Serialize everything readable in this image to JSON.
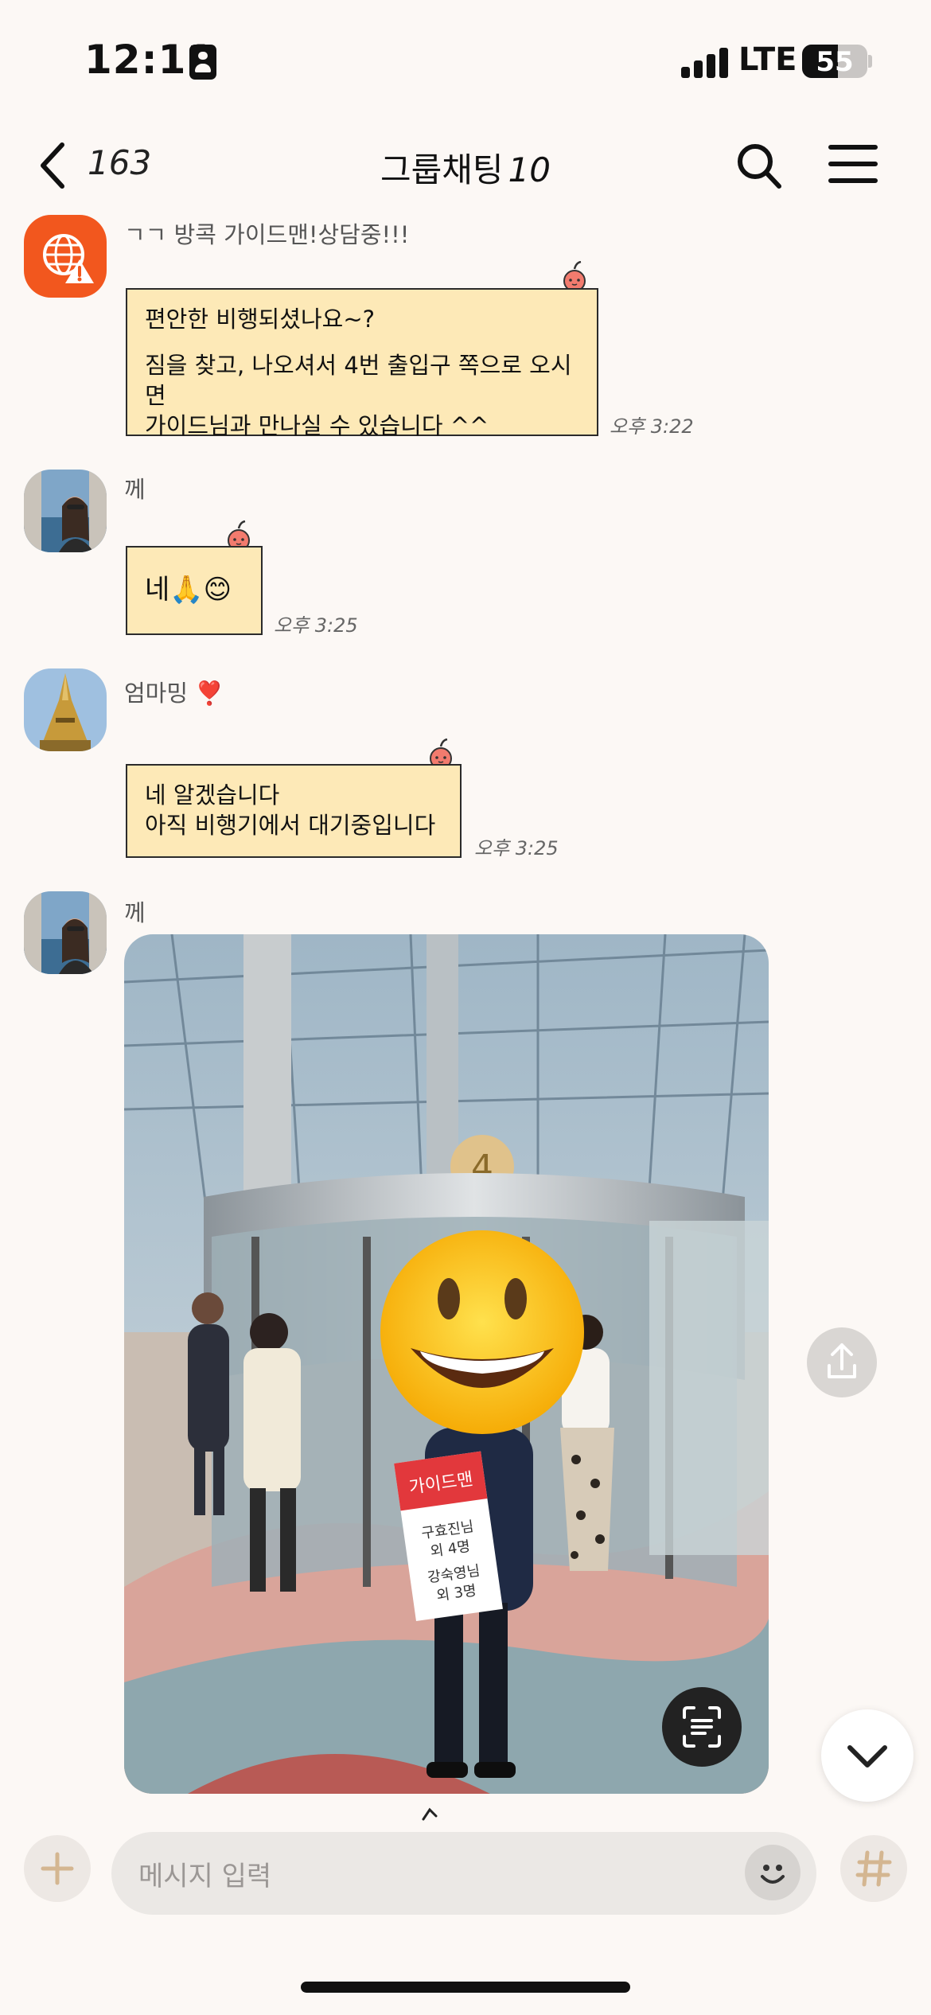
{
  "status_bar": {
    "time": "12:11",
    "network": "LTE",
    "battery": "55"
  },
  "nav": {
    "back_count": "163",
    "title": "그룹채팅",
    "member_count": "10"
  },
  "messages": [
    {
      "sender": "ㄱㄱ 방콕 가이드맨!상담중!!!",
      "line1": "편안한 비행되셨나요~?",
      "line2": "짐을 찾고, 나오셔서 4번 출입구 쪽으로 오시면",
      "line3": "가이드님과 만나실 수 있습니다 ^^",
      "time": "오후 3:22"
    },
    {
      "sender": "께",
      "text": "네🙏😊",
      "time": "오후 3:25"
    },
    {
      "sender": "엄마밍 ❣️",
      "line1": "네  알겠습니다",
      "line2": "아직  비행기에서  대기중입니다",
      "time": "오후 3:25"
    },
    {
      "sender": "께"
    }
  ],
  "photo": {
    "sign_brand": "가이드맨",
    "sign_line1": "구효진님",
    "sign_line2": "외 4명",
    "sign_line3": "강숙영님",
    "sign_line4": "외 3명",
    "gate_number": "4"
  },
  "input": {
    "placeholder": "메시지 입력"
  },
  "colors": {
    "background": "#fcf8f5",
    "bubble": "#fde9b7",
    "accent": "#f2571e"
  }
}
